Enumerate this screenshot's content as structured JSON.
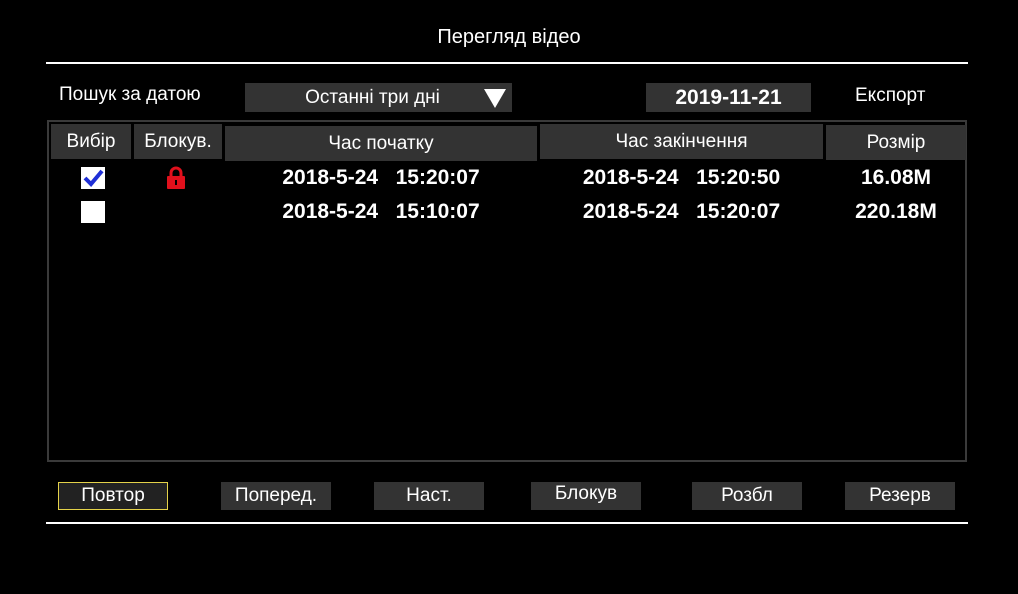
{
  "window": {
    "title": "Перегляд відео"
  },
  "search": {
    "label": "Пошук за датою",
    "range_selected": "Останні три дні",
    "date": "2019-11-21",
    "export_label": "Експорт"
  },
  "table": {
    "headers": {
      "select": "Вибір",
      "lock": "Блокув.",
      "start": "Час початку",
      "end": "Час закінчення",
      "size": "Розмір"
    },
    "rows": [
      {
        "checked": true,
        "locked": true,
        "start": "2018-5-24   15:20:07",
        "end": "2018-5-24   15:20:50",
        "size": "16.08M"
      },
      {
        "checked": false,
        "locked": false,
        "start": "2018-5-24   15:10:07",
        "end": "2018-5-24   15:20:07",
        "size": "220.18M"
      }
    ]
  },
  "buttons": {
    "replay": "Повтор",
    "prev": "Поперед.",
    "next": "Наст.",
    "lock": "Блокув",
    "unlock": "Розбл",
    "backup": "Резерв"
  },
  "colors": {
    "check": "#1f2fd6",
    "lock_icon": "#e0101c",
    "selected_border": "#e4d24a"
  },
  "icons": {
    "dropdown": "triangle-down-icon",
    "check": "checkmark-icon",
    "lock": "padlock-icon"
  }
}
